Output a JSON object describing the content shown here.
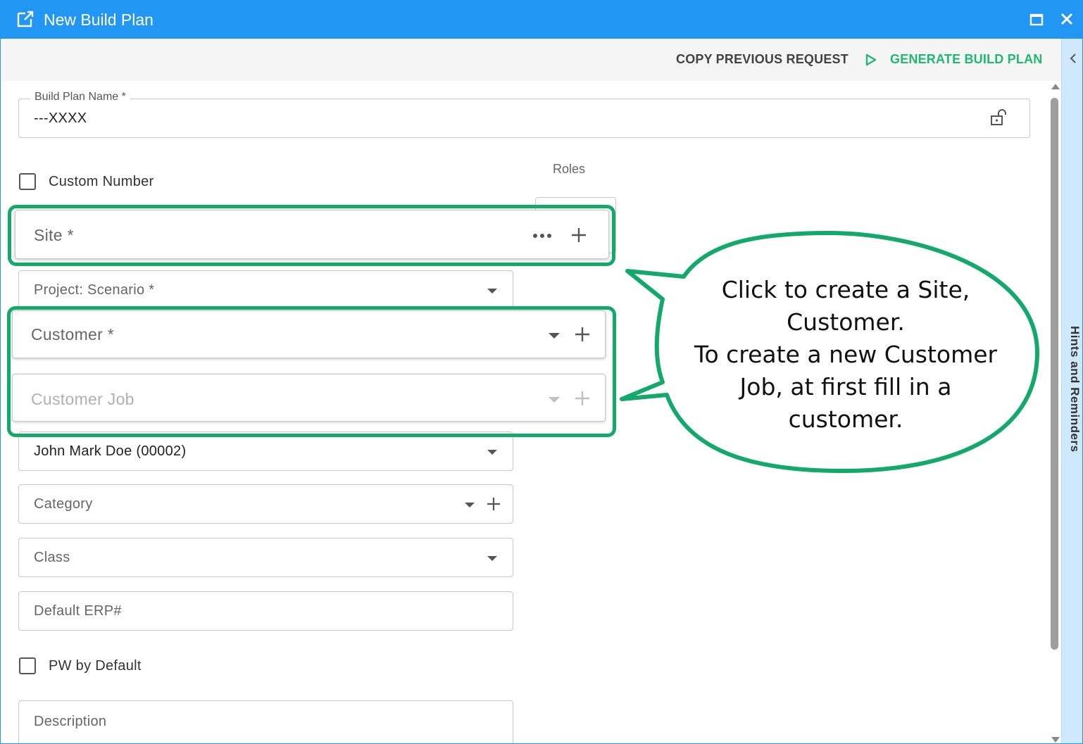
{
  "window": {
    "title": "New Build Plan"
  },
  "toolbar": {
    "copy_label": "COPY PREVIOUS REQUEST",
    "generate_label": "GENERATE BUILD PLAN"
  },
  "side_panel": {
    "label": "Hints and Reminders"
  },
  "form": {
    "build_plan_name": {
      "label": "Build Plan Name *",
      "value": "---XXXX"
    },
    "custom_number": {
      "label": "Custom Number",
      "checked": false
    },
    "roles": {
      "label": "Roles"
    },
    "site": {
      "placeholder": "Site *"
    },
    "project": {
      "placeholder": "Project: Scenario *"
    },
    "customer": {
      "placeholder": "Customer *"
    },
    "customer_job": {
      "placeholder": "Customer Job"
    },
    "pp_contact": {
      "value": "John Mark Doe (00002)"
    },
    "category": {
      "placeholder": "Category"
    },
    "class": {
      "placeholder": "Class"
    },
    "default_erp": {
      "placeholder": "Default ERP#"
    },
    "pw_by_default": {
      "label": "PW by Default",
      "checked": false
    },
    "description": {
      "placeholder": "Description"
    }
  },
  "callout": {
    "line1": "Click to create a Site,",
    "line2": "Customer.",
    "line3": "To create a new Customer",
    "line4": "Job, at first fill in a",
    "line5": "customer."
  },
  "colors": {
    "titlebar": "#2196f3",
    "accent_green": "#12a96a",
    "generate_green": "#1fb870",
    "side_panel": "#cfe8fb"
  }
}
